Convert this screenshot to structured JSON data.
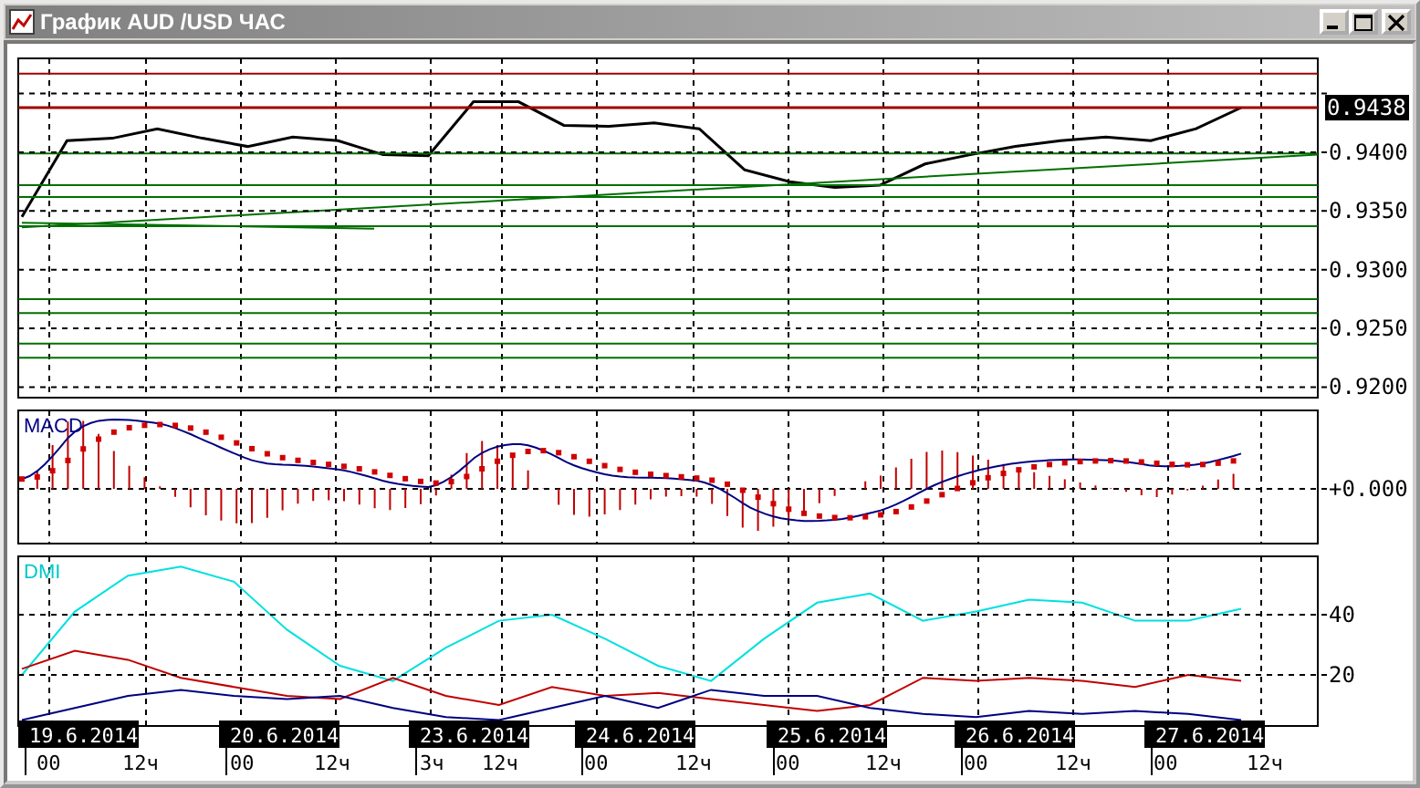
{
  "window": {
    "title": "График AUD /USD  ЧАС"
  },
  "price_panel": {
    "last_price": "0.9438",
    "chart_data": {
      "type": "line",
      "ylim": [
        0.9191,
        0.948
      ],
      "yticks": [
        {
          "value": 0.94,
          "label": "0.9400"
        },
        {
          "value": 0.935,
          "label": "0.9350"
        },
        {
          "value": 0.93,
          "label": "0.9300"
        },
        {
          "value": 0.925,
          "label": "0.9250"
        },
        {
          "value": 0.92,
          "label": "0.9200"
        }
      ],
      "series": [
        {
          "color": "#000000",
          "values": [
            0.9345,
            0.941,
            0.9412,
            0.942,
            0.9412,
            0.9405,
            0.9413,
            0.941,
            0.9398,
            0.9397,
            0.9443,
            0.9443,
            0.9423,
            0.9422,
            0.9425,
            0.942,
            0.9385,
            0.9375,
            0.937,
            0.9372,
            0.939,
            0.9398,
            0.9405,
            0.941,
            0.9413,
            0.941,
            0.942,
            0.9438
          ]
        }
      ]
    }
  },
  "macd_panel": {
    "label": "MACD",
    "zero_label": "+0.000"
  },
  "dmi_panel": {
    "label": "DMI",
    "chart_data": {
      "type": "line",
      "ylim": [
        3,
        59.4
      ],
      "yticks": [
        20,
        40
      ],
      "series": [
        {
          "color": "#00e0e0",
          "values": [
            20,
            41,
            53,
            56,
            51,
            35,
            23,
            18,
            29,
            38,
            40,
            32,
            23,
            18,
            32,
            44,
            47,
            38,
            41,
            45,
            44,
            38,
            38,
            42
          ]
        },
        {
          "color": "#c00000",
          "values": [
            22,
            28,
            25,
            19,
            16,
            13,
            12,
            19,
            13,
            10,
            16,
            13,
            14,
            12,
            10,
            8,
            10,
            19,
            18,
            19,
            18,
            16,
            20,
            18
          ]
        },
        {
          "color": "#000080",
          "values": [
            5,
            9,
            13,
            15,
            13,
            12,
            13,
            9,
            6,
            5,
            9,
            13,
            9,
            15,
            13,
            13,
            9,
            7,
            6,
            8,
            7,
            8,
            7,
            5
          ]
        }
      ]
    }
  },
  "time_axis": [
    {
      "date": "19.6.2014",
      "times": [
        "00",
        "12ч"
      ]
    },
    {
      "date": "20.6.2014",
      "times": [
        "00",
        "12ч"
      ]
    },
    {
      "date": "23.6.2014",
      "times": [
        "3ч",
        "12ч"
      ]
    },
    {
      "date": "24.6.2014",
      "times": [
        "00",
        "12ч"
      ]
    },
    {
      "date": "25.6.2014",
      "times": [
        "00",
        "12ч"
      ]
    },
    {
      "date": "26.6.2014",
      "times": [
        "00",
        "12ч"
      ]
    },
    {
      "date": "27.6.2014",
      "times": [
        "00",
        "12ч"
      ]
    }
  ]
}
